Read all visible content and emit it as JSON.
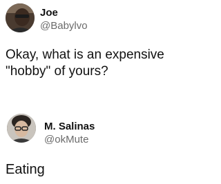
{
  "tweets": [
    {
      "display_name": "Joe",
      "handle": "@Babylvo",
      "text": "Okay, what is an expensive \"hobby\" of yours?",
      "avatar_icon": "profile-photo-icon"
    },
    {
      "display_name": "M. Salinas",
      "handle": "@okMute",
      "text": "Eating",
      "avatar_icon": "profile-photo-icon"
    }
  ],
  "colors": {
    "background": "#ffffff",
    "text": "#111111",
    "handle": "#6b6b6b"
  }
}
